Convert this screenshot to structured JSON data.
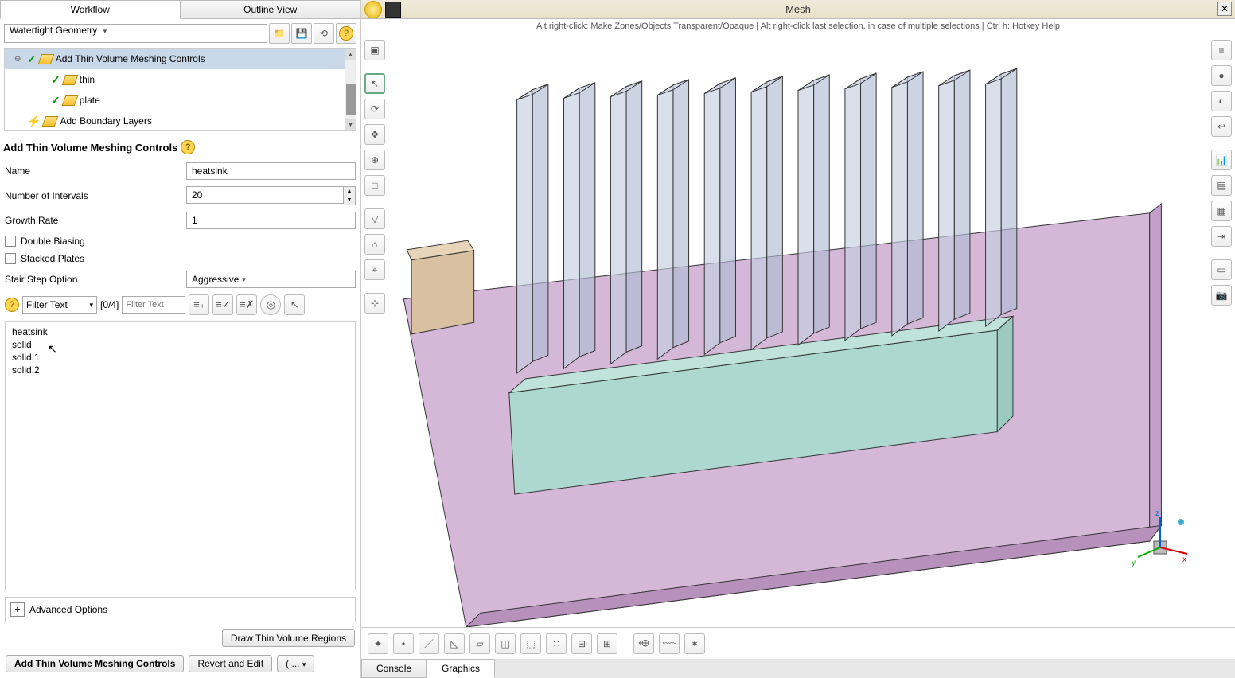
{
  "tabs": {
    "workflow": "Workflow",
    "outline": "Outline View"
  },
  "workflowSelect": "Watertight Geometry",
  "tree": {
    "items": [
      {
        "label": "Add Thin Volume Meshing Controls",
        "indent": 0,
        "toggle": "⊖",
        "status": "check",
        "selected": true
      },
      {
        "label": "thin",
        "indent": 1,
        "status": "check"
      },
      {
        "label": "plate",
        "indent": 1,
        "status": "check"
      },
      {
        "label": "Add Boundary Layers",
        "indent": 0,
        "status": "lightning"
      }
    ]
  },
  "section": {
    "title": "Add Thin Volume Meshing Controls",
    "name_label": "Name",
    "name_value": "heatsink",
    "intervals_label": "Number of Intervals",
    "intervals_value": "20",
    "growth_label": "Growth Rate",
    "growth_value": "1",
    "double_biasing": "Double Biasing",
    "stacked_plates": "Stacked Plates",
    "stairstep_label": "Stair Step Option",
    "stairstep_value": "Aggressive"
  },
  "filter": {
    "mode": "Filter Text",
    "count": "[0/4]",
    "placeholder": "Filter Text"
  },
  "list": [
    "heatsink",
    "solid",
    "solid.1",
    "solid.2"
  ],
  "advanced": "Advanced Options",
  "draw_btn": "Draw Thin Volume Regions",
  "actions": {
    "main": "Add Thin Volume Meshing Controls",
    "revert": "Revert and Edit",
    "more": "( ... "
  },
  "mesh": {
    "title": "Mesh",
    "hint": "Alt right-click: Make Zones/Objects Transparent/Opaque | Alt right-click last selection, in case of multiple selections | Ctrl h: Hotkey Help"
  },
  "bottomTabs": {
    "console": "Console",
    "graphics": "Graphics"
  },
  "axes": {
    "x": "x",
    "y": "y",
    "z": "z"
  },
  "icons": {
    "open": "📁",
    "save": "💾",
    "reset": "⟲",
    "help": "?",
    "pointer": "↖",
    "rotate": "⟳",
    "pan": "✥",
    "zoomin": "⊕",
    "zoomfit": "□",
    "zoomout": "⊖",
    "tri": "▽",
    "fitA": "⌂",
    "fitB": "⌖",
    "axis": "⊹",
    "persp": "⬓",
    "r1": "≡",
    "r2": "●",
    "r3": "◐",
    "r4": "↩",
    "r5": "📊",
    "r6": "▤",
    "r7": "▦",
    "r8": "⇥",
    "r9": "▭",
    "r10": "📷",
    "b1": "✦",
    "b2": "•",
    "b3": "／",
    "b4": "◺",
    "b5": "▱",
    "b6": "◫",
    "b7": "⬚",
    "b8": "∷",
    "b9": "⊟",
    "b10": "⊞",
    "b11": "⬲",
    "b12": "⬳",
    "b13": "✶"
  }
}
